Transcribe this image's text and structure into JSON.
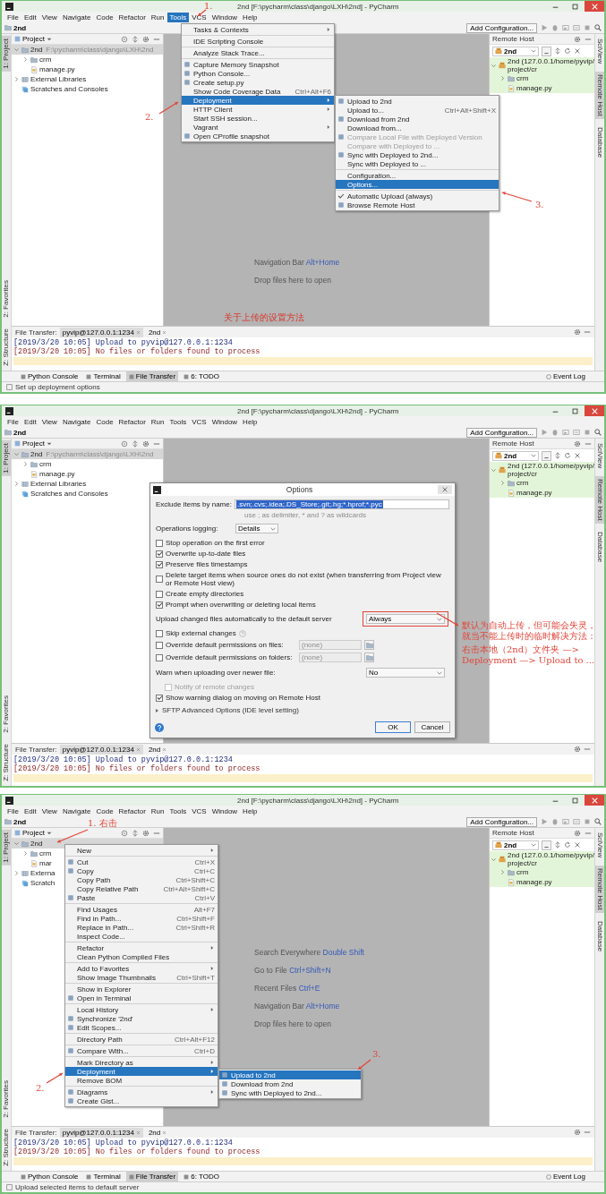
{
  "panels": [
    {
      "window": {
        "title": "2nd [F:\\pycharm\\class\\django\\LXH\\2nd] - PyCharm"
      },
      "menu_bar": [
        {
          "label": "File",
          "selected": false
        },
        {
          "label": "Edit",
          "selected": false
        },
        {
          "label": "View",
          "selected": false
        },
        {
          "label": "Navigate",
          "selected": false
        },
        {
          "label": "Code",
          "selected": false
        },
        {
          "label": "Refactor",
          "selected": false
        },
        {
          "label": "Run",
          "selected": false
        },
        {
          "label": "Tools",
          "selected": true
        },
        {
          "label": "VCS",
          "selected": false
        },
        {
          "label": "Window",
          "selected": false
        },
        {
          "label": "Help",
          "selected": false
        }
      ],
      "breadcrumb": "2nd",
      "run_config": "Add Configuration...",
      "left_stripe": {
        "top": [
          {
            "label": "1: Project",
            "selected": true
          }
        ],
        "bottom": [
          {
            "label": "2: Favorites",
            "selected": false
          },
          {
            "label": "Z: Structure",
            "selected": false
          }
        ]
      },
      "right_stripe": [
        {
          "label": "SciView",
          "selected": false
        },
        {
          "label": "Remote Host",
          "selected": true
        },
        {
          "label": "Database",
          "selected": false
        }
      ],
      "project": {
        "title": "Project",
        "tree": [
          {
            "label": "2nd",
            "path": "F:\\pycharm\\class\\django\\LXH\\2nd",
            "kind": "folder",
            "expanded": true,
            "selected": true,
            "children": [
              {
                "label": "crm",
                "kind": "folder",
                "expanded": false,
                "selected": false
              },
              {
                "label": "manage.py",
                "kind": "file",
                "selected": false
              }
            ]
          },
          {
            "label": "External Libraries",
            "kind": "library",
            "expanded": false,
            "selected": false
          },
          {
            "label": "Scratches and Consoles",
            "kind": "scratches",
            "selected": false
          }
        ]
      },
      "remote_host": {
        "title": "Remote Host",
        "server": "2nd",
        "tree": [
          {
            "label": "2nd (127.0.0.1/home/pyvip/project/cr",
            "kind": "server",
            "expanded": true,
            "selected": false,
            "children": [
              {
                "label": "crm",
                "kind": "folder",
                "expanded": false,
                "selected": false
              },
              {
                "label": "manage.py",
                "kind": "file",
                "selected": false
              }
            ]
          }
        ]
      },
      "editor": {
        "hints": [
          {
            "label": "Navigation Bar",
            "shortcut": "Alt+Home"
          },
          {
            "label": "Drop files here to open"
          }
        ],
        "note": "关于上传的设置方法"
      },
      "transfer": {
        "title": "File Transfer:",
        "tabs": [
          {
            "label": "pyvip@127.0.0.1:1234",
            "selected": true
          },
          {
            "label": "2nd",
            "selected": false
          }
        ],
        "lines": [
          {
            "text": "[2019/3/20 10:05] Upload to pyvip@127.0.0.1:1234",
            "kind": "info"
          },
          {
            "text": "[2019/3/20 10:05] No files or folders found to process",
            "kind": "error"
          }
        ]
      },
      "tool_tabs": [
        {
          "label": "Python Console",
          "selected": false
        },
        {
          "label": "Terminal",
          "selected": false
        },
        {
          "label": "File Transfer",
          "selected": true
        },
        {
          "label": "6: TODO",
          "selected": false
        }
      ],
      "event_log": "Event Log",
      "status": "Set up deployment options",
      "menus": [
        {
          "items": [
            {
              "label": "Tasks & Contexts",
              "kind": "plain",
              "submenu": true,
              "selected": false
            },
            {
              "kind": "separator"
            },
            {
              "label": "IDE Scripting Console",
              "kind": "plain",
              "submenu": false,
              "selected": false
            },
            {
              "kind": "separator"
            },
            {
              "label": "Analyze Stack Trace...",
              "kind": "plain",
              "submenu": false,
              "selected": false
            },
            {
              "kind": "separator"
            },
            {
              "label": "Capture Memory Snapshot",
              "kind": "icon",
              "submenu": false,
              "selected": false
            },
            {
              "label": "Python Console...",
              "kind": "icon",
              "submenu": false,
              "selected": false
            },
            {
              "label": "Create setup.py",
              "kind": "icon",
              "submenu": false,
              "selected": false
            },
            {
              "label": "Show Code Coverage Data",
              "shortcut": "Ctrl+Alt+F6",
              "kind": "plain",
              "submenu": false,
              "selected": false
            },
            {
              "label": "Deployment",
              "kind": "plain",
              "submenu": true,
              "selected": true
            },
            {
              "label": "HTTP Client",
              "kind": "plain",
              "submenu": true,
              "selected": false
            },
            {
              "label": "Start SSH session...",
              "kind": "plain",
              "submenu": false,
              "selected": false
            },
            {
              "label": "Vagrant",
              "kind": "plain",
              "submenu": true,
              "selected": false
            },
            {
              "label": "Open CProfile snapshot",
              "kind": "icon",
              "submenu": false,
              "selected": false
            }
          ]
        },
        {
          "items": [
            {
              "label": "Upload to 2nd",
              "kind": "icon",
              "submenu": false,
              "selected": false,
              "disabled": false
            },
            {
              "label": "Upload to...",
              "shortcut": "Ctrl+Alt+Shift+X",
              "kind": "plain",
              "submenu": false,
              "selected": false,
              "disabled": false
            },
            {
              "label": "Download from 2nd",
              "kind": "icon",
              "submenu": false,
              "selected": false,
              "disabled": false
            },
            {
              "label": "Download from...",
              "kind": "plain",
              "submenu": false,
              "selected": false,
              "disabled": false
            },
            {
              "label": "Compare Local File with Deployed Version",
              "kind": "icon",
              "submenu": false,
              "selected": false,
              "disabled": true
            },
            {
              "label": "Compare with Deployed to ...",
              "kind": "plain",
              "submenu": false,
              "selected": false,
              "disabled": true
            },
            {
              "label": "Sync with Deployed to 2nd...",
              "kind": "icon",
              "submenu": false,
              "selected": false,
              "disabled": false
            },
            {
              "label": "Sync with Deployed to ...",
              "kind": "plain",
              "submenu": false,
              "selected": false,
              "disabled": false
            },
            {
              "kind": "separator"
            },
            {
              "label": "Configuration...",
              "kind": "plain",
              "submenu": false,
              "selected": false,
              "disabled": false
            },
            {
              "label": "Options...",
              "kind": "plain",
              "submenu": false,
              "selected": true,
              "disabled": false
            },
            {
              "kind": "separator"
            },
            {
              "label": "Automatic Upload (always)",
              "kind": "check",
              "checked": true,
              "submenu": false,
              "selected": false,
              "disabled": false
            },
            {
              "label": "Browse Remote Host",
              "kind": "icon",
              "submenu": false,
              "selected": false,
              "disabled": false
            }
          ]
        }
      ],
      "annotations": [
        {
          "label": "1."
        },
        {
          "label": "2."
        },
        {
          "label": "3."
        }
      ]
    },
    {
      "window": {
        "title": "2nd [F:\\pycharm\\class\\django\\LXH\\2nd] - PyCharm"
      },
      "menu_bar": [
        {
          "label": "File",
          "selected": false
        },
        {
          "label": "Edit",
          "selected": false
        },
        {
          "label": "View",
          "selected": false
        },
        {
          "label": "Navigate",
          "selected": false
        },
        {
          "label": "Code",
          "selected": false
        },
        {
          "label": "Refactor",
          "selected": false
        },
        {
          "label": "Run",
          "selected": false
        },
        {
          "label": "Tools",
          "selected": false
        },
        {
          "label": "VCS",
          "selected": false
        },
        {
          "label": "Window",
          "selected": false
        },
        {
          "label": "Help",
          "selected": false
        }
      ],
      "breadcrumb": "2nd",
      "run_config": "Add Configuration...",
      "left_stripe": {
        "top": [
          {
            "label": "1: Project",
            "selected": true
          }
        ],
        "bottom": [
          {
            "label": "2: Favorites",
            "selected": false
          },
          {
            "label": "Z: Structure",
            "selected": false
          }
        ]
      },
      "right_stripe": [
        {
          "label": "SciView",
          "selected": false
        },
        {
          "label": "Remote Host",
          "selected": true
        },
        {
          "label": "Database",
          "selected": false
        }
      ],
      "project": {
        "title": "Project",
        "tree": [
          {
            "label": "2nd",
            "path": "F:\\pycharm\\class\\django\\LXH\\2nd",
            "kind": "folder",
            "expanded": true,
            "selected": true,
            "children": [
              {
                "label": "crm",
                "kind": "folder",
                "expanded": false,
                "selected": false
              },
              {
                "label": "manage.py",
                "kind": "file",
                "selected": false
              }
            ]
          },
          {
            "label": "External Libraries",
            "kind": "library",
            "expanded": false,
            "selected": false
          },
          {
            "label": "Scratches and Consoles",
            "kind": "scratches",
            "selected": false
          }
        ]
      },
      "remote_host": {
        "title": "Remote Host",
        "server": "2nd",
        "tree": [
          {
            "label": "2nd (127.0.0.1/home/pyvip/project/cr",
            "kind": "server",
            "expanded": true,
            "selected": false,
            "children": [
              {
                "label": "crm",
                "kind": "folder",
                "expanded": false,
                "selected": false
              },
              {
                "label": "manage.py",
                "kind": "file",
                "selected": false
              }
            ]
          }
        ]
      },
      "transfer": {
        "title": "File Transfer:",
        "tabs": [
          {
            "label": "pyvip@127.0.0.1:1234",
            "selected": true
          },
          {
            "label": "2nd",
            "selected": false
          }
        ],
        "lines": [
          {
            "text": "[2019/3/20 10:05] Upload to pyvip@127.0.0.1:1234",
            "kind": "info"
          },
          {
            "text": "[2019/3/20 10:05] No files or folders found to process",
            "kind": "error"
          }
        ]
      },
      "dialog": {
        "title": "Options",
        "exclude": {
          "label": "Exclude items by name:",
          "value": ".svn;.cvs;.idea;.DS_Store;.git;.hg;*.hprof;*.pyc",
          "hint": "use ; as delimiter, * and ? as wildcards"
        },
        "rows": [
          {
            "kind": "select",
            "label": "Operations logging:",
            "value": "Details",
            "highlighted": false
          },
          {
            "kind": "checkbox",
            "label": "Stop operation on the first error",
            "checked": false,
            "disabled": false,
            "highlighted": false
          },
          {
            "kind": "checkbox",
            "label": "Overwrite up-to-date files",
            "checked": true,
            "disabled": false,
            "highlighted": false
          },
          {
            "kind": "checkbox",
            "label": "Preserve files timestamps",
            "checked": true,
            "disabled": false,
            "highlighted": false
          },
          {
            "kind": "checkbox",
            "label": "Delete target items when source ones do not exist (when transferring from Project view or Remote Host view)",
            "checked": false,
            "disabled": false,
            "highlighted": false
          },
          {
            "kind": "checkbox",
            "label": "Create empty directories",
            "checked": false,
            "disabled": false,
            "highlighted": false
          },
          {
            "kind": "checkbox",
            "label": "Prompt when overwriting or deleting local items",
            "checked": true,
            "disabled": false,
            "highlighted": false
          },
          {
            "kind": "select",
            "label": "Upload changed files automatically to the default server",
            "value": "Always",
            "highlighted": true
          },
          {
            "kind": "helpcheckbox",
            "label": "Skip external changes",
            "checked": false,
            "disabled": false,
            "highlighted": false
          },
          {
            "kind": "permission",
            "label": "Override default permissions on files:",
            "checked": false,
            "value": "(none)",
            "highlighted": false
          },
          {
            "kind": "permission",
            "label": "Override default permissions on folders:",
            "checked": false,
            "value": "(none)",
            "highlighted": false
          },
          {
            "kind": "select",
            "label": "Warn when uploading over newer file:",
            "value": "No",
            "highlighted": false
          },
          {
            "kind": "subcheckbox",
            "label": "Notify of remote changes",
            "checked": false,
            "disabled": true,
            "highlighted": false
          },
          {
            "kind": "checkbox",
            "label": "Show warning dialog on moving on Remote Host",
            "checked": true,
            "disabled": false,
            "highlighted": false
          }
        ],
        "advanced": {
          "label": "SFTP Advanced Options (IDE level setting)",
          "expanded": false
        },
        "buttons": [
          {
            "label": "OK",
            "kind": "default"
          },
          {
            "label": "Cancel",
            "kind": "normal"
          }
        ]
      },
      "annotations": [
        {
          "label": "默认为自动上传，但可能会失灵，就当不能上传时的临时解决方法："
        },
        {
          "label": "右击本地（2nd）文件夹 —> Deployment —> Upload to ..."
        }
      ]
    },
    {
      "window": {
        "title": "2nd [F:\\pycharm\\class\\django\\LXH\\2nd] - PyCharm"
      },
      "menu_bar": [
        {
          "label": "File",
          "selected": false
        },
        {
          "label": "Edit",
          "selected": false
        },
        {
          "label": "View",
          "selected": false
        },
        {
          "label": "Navigate",
          "selected": false
        },
        {
          "label": "Code",
          "selected": false
        },
        {
          "label": "Refactor",
          "selected": false
        },
        {
          "label": "Run",
          "selected": false
        },
        {
          "label": "Tools",
          "selected": false
        },
        {
          "label": "VCS",
          "selected": false
        },
        {
          "label": "Window",
          "selected": false
        },
        {
          "label": "Help",
          "selected": false
        }
      ],
      "breadcrumb": "2nd",
      "run_config": "Add Configuration...",
      "left_stripe": {
        "top": [
          {
            "label": "1: Project",
            "selected": true
          }
        ],
        "bottom": [
          {
            "label": "2: Favorites",
            "selected": false
          },
          {
            "label": "Z: Structure",
            "selected": false
          }
        ]
      },
      "right_stripe": [
        {
          "label": "SciView",
          "selected": false
        },
        {
          "label": "Remote Host",
          "selected": true
        },
        {
          "label": "Database",
          "selected": false
        }
      ],
      "project": {
        "title": "Project",
        "tree": [
          {
            "label": "2nd",
            "kind": "folder",
            "expanded": true,
            "selected": true,
            "children": [
              {
                "label": "crm",
                "kind": "folder",
                "expanded": false,
                "selected": false
              },
              {
                "label": "mar",
                "kind": "file",
                "selected": false
              }
            ]
          },
          {
            "label": "Externa",
            "kind": "library",
            "expanded": false,
            "selected": false
          },
          {
            "label": "Scratch",
            "kind": "scratches",
            "selected": false
          }
        ]
      },
      "remote_host": {
        "title": "Remote Host",
        "server": "2nd",
        "tree": [
          {
            "label": "2nd (127.0.0.1/home/pyvip/project/cr",
            "kind": "server",
            "expanded": true,
            "selected": false,
            "children": [
              {
                "label": "crm",
                "kind": "folder",
                "expanded": false,
                "selected": false
              },
              {
                "label": "manage.py",
                "kind": "file",
                "selected": false
              }
            ]
          }
        ]
      },
      "editor": {
        "hints": [
          {
            "label": "Search Everywhere",
            "shortcut": "Double Shift"
          },
          {
            "label": "Go to File",
            "shortcut": "Ctrl+Shift+N"
          },
          {
            "label": "Recent Files",
            "shortcut": "Ctrl+E"
          },
          {
            "label": "Navigation Bar",
            "shortcut": "Alt+Home"
          },
          {
            "label": "Drop files here to open"
          }
        ]
      },
      "transfer": {
        "title": "File Transfer:",
        "tabs": [
          {
            "label": "pyvip@127.0.0.1:1234",
            "selected": true
          },
          {
            "label": "2nd",
            "selected": false
          }
        ],
        "lines": [
          {
            "text": "[2019/3/20 10:05] Upload to pyvip@127.0.0.1:1234",
            "kind": "info"
          },
          {
            "text": "[2019/3/20 10:05] No files or folders found to process",
            "kind": "error"
          }
        ]
      },
      "tool_tabs": [
        {
          "label": "Python Console",
          "selected": false
        },
        {
          "label": "Terminal",
          "selected": false
        },
        {
          "label": "File Transfer",
          "selected": true
        },
        {
          "label": "6: TODO",
          "selected": false
        }
      ],
      "event_log": "Event Log",
      "status": "Upload selected items to default server",
      "menus": [
        {
          "items": [
            {
              "label": "New",
              "kind": "plain",
              "submenu": true,
              "selected": false
            },
            {
              "kind": "separator"
            },
            {
              "label": "Cut",
              "shortcut": "Ctrl+X",
              "kind": "icon",
              "submenu": false,
              "selected": false
            },
            {
              "label": "Copy",
              "shortcut": "Ctrl+C",
              "kind": "icon",
              "submenu": false,
              "selected": false
            },
            {
              "label": "Copy Path",
              "shortcut": "Ctrl+Shift+C",
              "kind": "plain",
              "submenu": false,
              "selected": false
            },
            {
              "label": "Copy Relative Path",
              "shortcut": "Ctrl+Alt+Shift+C",
              "kind": "plain",
              "submenu": false,
              "selected": false
            },
            {
              "label": "Paste",
              "shortcut": "Ctrl+V",
              "kind": "icon",
              "submenu": false,
              "selected": false
            },
            {
              "kind": "separator"
            },
            {
              "label": "Find Usages",
              "shortcut": "Alt+F7",
              "kind": "plain",
              "submenu": false,
              "selected": false
            },
            {
              "label": "Find in Path...",
              "shortcut": "Ctrl+Shift+F",
              "kind": "plain",
              "submenu": false,
              "selected": false
            },
            {
              "label": "Replace in Path...",
              "shortcut": "Ctrl+Shift+R",
              "kind": "plain",
              "submenu": false,
              "selected": false
            },
            {
              "label": "Inspect Code...",
              "kind": "plain",
              "submenu": false,
              "selected": false
            },
            {
              "kind": "separator"
            },
            {
              "label": "Refactor",
              "kind": "plain",
              "submenu": true,
              "selected": false
            },
            {
              "label": "Clean Python Compiled Files",
              "kind": "plain",
              "submenu": false,
              "selected": false
            },
            {
              "kind": "separator"
            },
            {
              "label": "Add to Favorites",
              "kind": "plain",
              "submenu": true,
              "selected": false
            },
            {
              "label": "Show Image Thumbnails",
              "shortcut": "Ctrl+Shift+T",
              "kind": "plain",
              "submenu": false,
              "selected": false
            },
            {
              "kind": "separator"
            },
            {
              "label": "Show in Explorer",
              "kind": "plain",
              "submenu": false,
              "selected": false
            },
            {
              "label": "Open in Terminal",
              "kind": "icon",
              "submenu": false,
              "selected": false
            },
            {
              "kind": "separator"
            },
            {
              "label": "Local History",
              "kind": "plain",
              "submenu": true,
              "selected": false
            },
            {
              "label": "Synchronize '2nd'",
              "kind": "icon",
              "submenu": false,
              "selected": false
            },
            {
              "label": "Edit Scopes...",
              "kind": "icon",
              "submenu": false,
              "selected": false
            },
            {
              "kind": "separator"
            },
            {
              "label": "Directory Path",
              "shortcut": "Ctrl+Alt+F12",
              "kind": "plain",
              "submenu": false,
              "selected": false
            },
            {
              "kind": "separator"
            },
            {
              "label": "Compare With...",
              "shortcut": "Ctrl+D",
              "kind": "icon",
              "submenu": false,
              "selected": false
            },
            {
              "kind": "separator"
            },
            {
              "label": "Mark Directory as",
              "kind": "plain",
              "submenu": true,
              "selected": false
            },
            {
              "label": "Deployment",
              "kind": "plain",
              "submenu": true,
              "selected": true
            },
            {
              "label": "Remove BOM",
              "kind": "plain",
              "submenu": false,
              "selected": false
            },
            {
              "kind": "separator"
            },
            {
              "label": "Diagrams",
              "kind": "icon",
              "submenu": true,
              "selected": false
            },
            {
              "label": "Create Gist...",
              "kind": "icon",
              "submenu": false,
              "selected": false
            }
          ]
        },
        {
          "items": [
            {
              "label": "Upload to 2nd",
              "kind": "icon",
              "submenu": false,
              "selected": true
            },
            {
              "label": "Download from 2nd",
              "kind": "icon",
              "submenu": false,
              "selected": false
            },
            {
              "label": "Sync with Deployed to 2nd...",
              "kind": "icon",
              "submenu": false,
              "selected": false
            }
          ]
        }
      ],
      "annotations": [
        {
          "label": "1. 右击"
        },
        {
          "label": "2."
        },
        {
          "label": "3."
        }
      ]
    }
  ]
}
